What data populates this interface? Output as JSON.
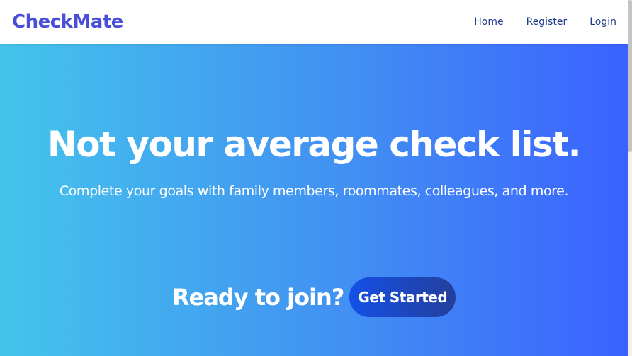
{
  "brand": {
    "name": "CheckMate",
    "color": "#4b4fd8"
  },
  "nav": {
    "items": [
      {
        "label": "Home"
      },
      {
        "label": "Register"
      },
      {
        "label": "Login"
      }
    ]
  },
  "hero": {
    "headline": "Not your average check list.",
    "subheadline": "Complete your goals with family members, roommates, colleagues, and more.",
    "cta_text": "Ready to join?",
    "cta_button": "Get Started",
    "gradient_colors": [
      "#44c4ec",
      "#4290f2",
      "#3b62ff"
    ]
  }
}
